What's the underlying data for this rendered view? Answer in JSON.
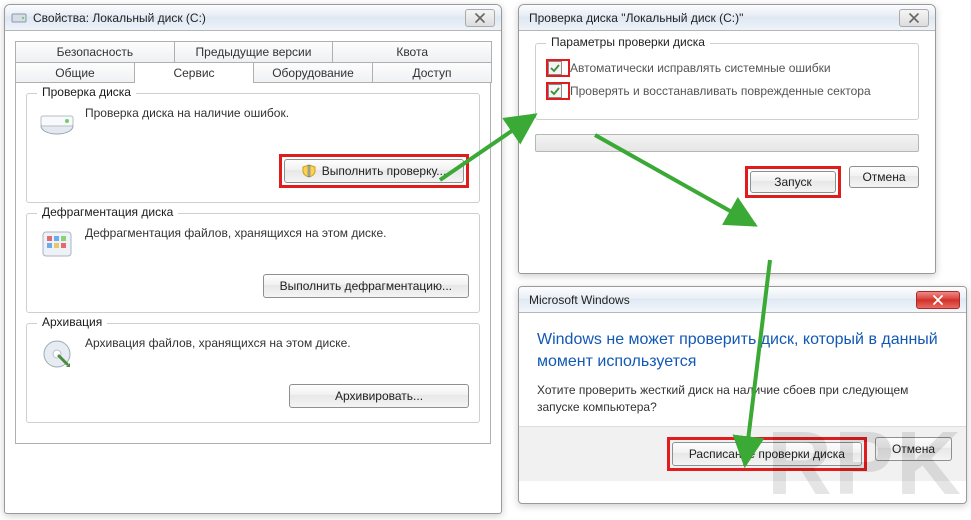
{
  "watermark": "RPK",
  "props": {
    "title": "Свойства: Локальный диск (C:)",
    "tabs_row1": [
      "Безопасность",
      "Предыдущие версии",
      "Квота"
    ],
    "tabs_row2": [
      "Общие",
      "Сервис",
      "Оборудование",
      "Доступ"
    ],
    "active_tab": "Сервис",
    "group_check": {
      "legend": "Проверка диска",
      "text": "Проверка диска на наличие ошибок.",
      "button": "Выполнить проверку..."
    },
    "group_defrag": {
      "legend": "Дефрагментация диска",
      "text": "Дефрагментация файлов, хранящихся на этом диске.",
      "button": "Выполнить дефрагментацию..."
    },
    "group_backup": {
      "legend": "Архивация",
      "text": "Архивация файлов, хранящихся на этом диске.",
      "button": "Архивировать..."
    }
  },
  "checkdisk": {
    "title": "Проверка диска \"Локальный диск (C:)\"",
    "legend": "Параметры проверки диска",
    "opt1": "Автоматически исправлять системные ошибки",
    "opt2": "Проверять и восстанавливать поврежденные сектора",
    "start": "Запуск",
    "cancel": "Отмена"
  },
  "msgbox": {
    "title": "Microsoft Windows",
    "headline": "Windows не может проверить диск, который в данный момент используется",
    "body": "Хотите проверить жесткий диск на наличие сбоев при следующем запуске компьютера?",
    "schedule": "Расписание проверки диска",
    "cancel": "Отмена"
  },
  "colors": {
    "highlight": "#e01c1c",
    "arrow": "#3aa935"
  }
}
